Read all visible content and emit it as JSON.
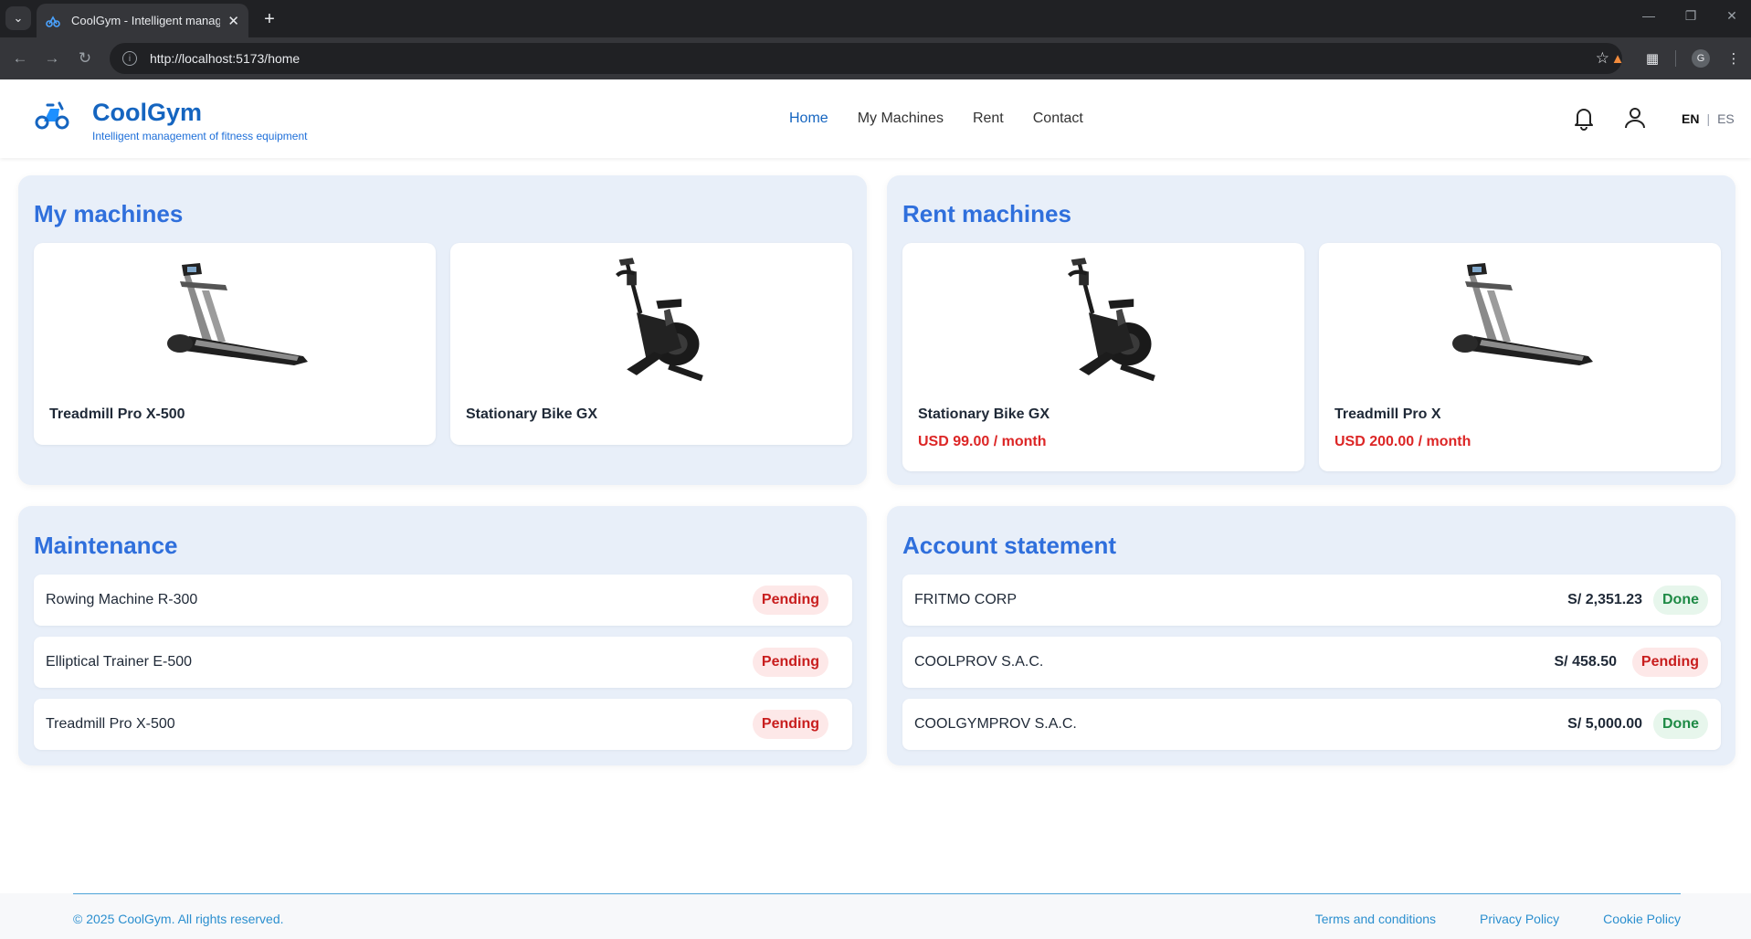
{
  "browser": {
    "tab_title": "CoolGym - Intelligent management",
    "url": "http://localhost:5173/home",
    "profile_initial": "G"
  },
  "header": {
    "brand": "CoolGym",
    "tagline": "Intelligent management of fitness equipment",
    "nav": [
      {
        "label": "Home",
        "active": true
      },
      {
        "label": "My Machines",
        "active": false
      },
      {
        "label": "Rent",
        "active": false
      },
      {
        "label": "Contact",
        "active": false
      }
    ],
    "lang": {
      "current": "EN",
      "separator": "|",
      "other": "ES"
    },
    "icons": [
      "bell-icon",
      "user-icon"
    ]
  },
  "my_machines": {
    "title": "My machines",
    "items": [
      {
        "name": "Treadmill Pro X-500",
        "image": "treadmill"
      },
      {
        "name": "Stationary Bike GX",
        "image": "bike"
      }
    ]
  },
  "rent_machines": {
    "title": "Rent machines",
    "items": [
      {
        "name": "Stationary Bike GX",
        "price": "USD 99.00 / month",
        "image": "bike"
      },
      {
        "name": "Treadmill Pro X",
        "price": "USD 200.00 / month",
        "image": "treadmill"
      }
    ]
  },
  "maintenance": {
    "title": "Maintenance",
    "items": [
      {
        "name": "Rowing Machine R-300",
        "status": "Pending"
      },
      {
        "name": "Elliptical Trainer E-500",
        "status": "Pending"
      },
      {
        "name": "Treadmill Pro X-500",
        "status": "Pending"
      }
    ]
  },
  "account_statement": {
    "title": "Account statement",
    "items": [
      {
        "name": "FRITMO CORP",
        "amount": "S/ 2,351.23",
        "status": "Done"
      },
      {
        "name": "COOLPROV S.A.C.",
        "amount": "S/ 458.50",
        "status": "Pending"
      },
      {
        "name": "COOLGYMPROV S.A.C.",
        "amount": "S/ 5,000.00",
        "status": "Done"
      }
    ]
  },
  "footer": {
    "copyright": "© 2025 CoolGym. All rights reserved.",
    "links": [
      "Terms and conditions",
      "Privacy Policy",
      "Cookie Policy"
    ]
  },
  "colors": {
    "brand": "#1565c0",
    "panel_bg": "#e8eff9",
    "price": "#dc2626",
    "pending": "#c81e1e",
    "done": "#1e8a45"
  }
}
